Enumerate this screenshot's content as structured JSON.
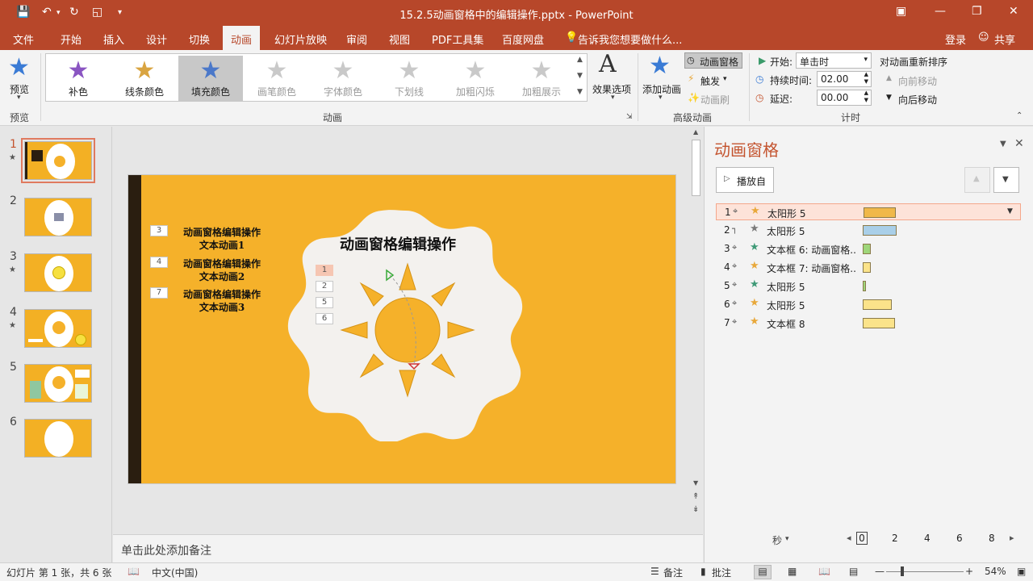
{
  "window": {
    "title": "15.2.5动画窗格中的编辑操作.pptx - PowerPoint"
  },
  "tabs": [
    "文件",
    "开始",
    "插入",
    "设计",
    "切换",
    "动画",
    "幻灯片放映",
    "审阅",
    "视图",
    "PDF工具集",
    "百度网盘",
    "告诉我您想要做什么..."
  ],
  "active_tab": "动画",
  "account": {
    "login": "登录",
    "share": "共享"
  },
  "ribbon": {
    "preview_label": "预览",
    "preview_group": "预览",
    "gallery": [
      "补色",
      "线条颜色",
      "填充颜色",
      "画笔颜色",
      "字体颜色",
      "下划线",
      "加粗闪烁",
      "加粗展示"
    ],
    "gallery_selected": "填充颜色",
    "effect_options": "效果选项",
    "anim_group": "动画",
    "add_animation": "添加动画",
    "anim_pane_btn": "动画窗格",
    "trigger_btn": "触发",
    "anim_painter_btn": "动画刷",
    "adv_group": "高级动画",
    "start_label": "开始:",
    "start_value": "单击时",
    "duration_label": "持续时间:",
    "duration_value": "02.00",
    "delay_label": "延迟:",
    "delay_value": "00.00",
    "reorder_label": "对动画重新排序",
    "move_earlier": "向前移动",
    "move_later": "向后移动",
    "timing_group": "计时"
  },
  "slides": [
    {
      "num": "1",
      "star": true
    },
    {
      "num": "2",
      "star": false
    },
    {
      "num": "3",
      "star": true
    },
    {
      "num": "4",
      "star": true
    },
    {
      "num": "5",
      "star": false
    },
    {
      "num": "6",
      "star": false
    }
  ],
  "slide": {
    "title": "动画窗格编辑操作",
    "items": [
      {
        "tag": "3",
        "line1": "动画窗格编辑操作",
        "line2": "文本动画1"
      },
      {
        "tag": "4",
        "line1": "动画窗格编辑操作",
        "line2": "文本动画2"
      },
      {
        "tag": "7",
        "line1": "动画窗格编辑操作",
        "line2": "文本动画3"
      }
    ],
    "sun_tags": [
      "1",
      "2",
      "5",
      "6"
    ]
  },
  "notes_placeholder": "单击此处添加备注",
  "anim_pane": {
    "title": "动画窗格",
    "play_from": "播放自",
    "rows": [
      {
        "n": "1",
        "star_color": "#e8a83a",
        "name": "太阳形 5",
        "bar_color": "#f0b84a"
      },
      {
        "n": "2",
        "star_color": "#7a7a7a",
        "name": "太阳形 5",
        "bar_color": "#a9cfe8"
      },
      {
        "n": "3",
        "star_color": "#3f9a77",
        "name": "文本框 6: 动画窗格...",
        "bar_color": "#9ed67a"
      },
      {
        "n": "4",
        "star_color": "#e8a83a",
        "name": "文本框 7: 动画窗格...",
        "bar_color": "#fbe38a"
      },
      {
        "n": "5",
        "star_color": "#3f9a77",
        "name": "太阳形 5",
        "bar_color": "#9ed67a"
      },
      {
        "n": "6",
        "star_color": "#e8a83a",
        "name": "太阳形 5",
        "bar_color": "#fbe38a"
      },
      {
        "n": "7",
        "star_color": "#e8a83a",
        "name": "文本框 8",
        "bar_color": "#fbe38a"
      }
    ],
    "seconds_label": "秒",
    "timeline": [
      "0",
      "2",
      "4",
      "6",
      "8"
    ]
  },
  "status": {
    "slide_info": "幻灯片 第 1 张，共 6 张",
    "language": "中文(中国)",
    "notes": "备注",
    "comments": "批注",
    "zoom": "54%"
  },
  "colors": {
    "accent": "#b7472a",
    "slide_bg": "#f5b12a",
    "selection": "#fde3d9"
  }
}
